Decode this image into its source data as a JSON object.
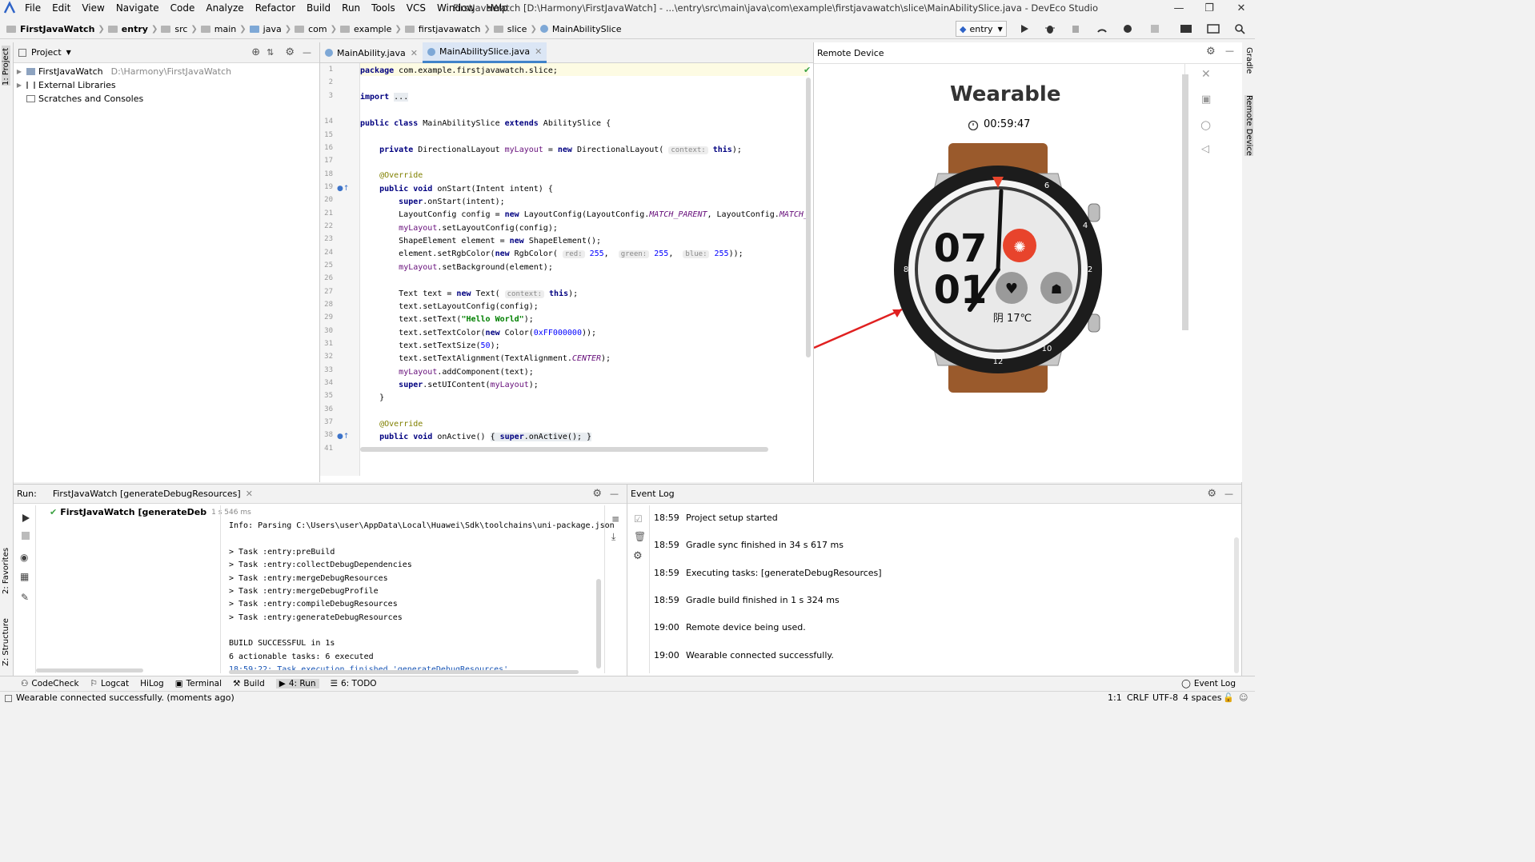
{
  "menu": [
    "File",
    "Edit",
    "View",
    "Navigate",
    "Code",
    "Analyze",
    "Refactor",
    "Build",
    "Run",
    "Tools",
    "VCS",
    "Window",
    "Help"
  ],
  "window_title": "FirstJavaWatch [D:\\Harmony\\FirstJavaWatch] - ...\\entry\\src\\main\\java\\com\\example\\firstjavawatch\\slice\\MainAbilitySlice.java - DevEco Studio",
  "breadcrumb": [
    "FirstJavaWatch",
    "entry",
    "src",
    "main",
    "java",
    "com",
    "example",
    "firstjavawatch",
    "slice",
    "MainAbilitySlice"
  ],
  "run_config": "entry",
  "left_strip": {
    "project": "1: Project",
    "favorites": "2: Favorites",
    "structure": "Z: Structure"
  },
  "right_strip": {
    "gradle": "Gradle",
    "remote": "Remote Device"
  },
  "project": {
    "title": "Project",
    "items": [
      {
        "name": "FirstJavaWatch",
        "path": "D:\\Harmony\\FirstJavaWatch"
      },
      {
        "name": "External Libraries",
        "path": ""
      },
      {
        "name": "Scratches and Consoles",
        "path": ""
      }
    ]
  },
  "editor": {
    "tabs": [
      "MainAbility.java",
      "MainAbilitySlice.java"
    ],
    "line_numbers": [
      "1",
      "2",
      "3",
      "14",
      "15",
      "16",
      "17",
      "18",
      "19",
      "20",
      "21",
      "22",
      "23",
      "24",
      "25",
      "26",
      "27",
      "28",
      "29",
      "30",
      "31",
      "32",
      "33",
      "34",
      "35",
      "36",
      "37",
      "38",
      "41"
    ]
  },
  "remote": {
    "title": "Remote Device",
    "device_label": "Wearable",
    "timer": "00:59:47",
    "watch": {
      "hour": "07",
      "minute": "01",
      "weather": "阴 17℃",
      "bezel_marks": [
        "2",
        "4",
        "6",
        "8",
        "10",
        "12"
      ]
    }
  },
  "run": {
    "label": "Run:",
    "tab": "FirstJavaWatch [generateDebugResources]",
    "tree_item": "FirstJavaWatch [generateDeb",
    "tree_time": "1 s 546 ms",
    "console": [
      "Info: Parsing C:\\Users\\user\\AppData\\Local\\Huawei\\Sdk\\toolchains\\uni-package.json",
      "",
      "> Task :entry:preBuild",
      "> Task :entry:collectDebugDependencies",
      "> Task :entry:mergeDebugResources",
      "> Task :entry:mergeDebugProfile",
      "> Task :entry:compileDebugResources",
      "> Task :entry:generateDebugResources",
      "",
      "BUILD SUCCESSFUL in 1s",
      "6 actionable tasks: 6 executed",
      "18:59:22: Task execution finished 'generateDebugResources'."
    ]
  },
  "event_log": {
    "title": "Event Log",
    "entries": [
      {
        "time": "18:59",
        "msg": "Project setup started"
      },
      {
        "time": "18:59",
        "msg": "Gradle sync finished in 34 s 617 ms"
      },
      {
        "time": "18:59",
        "msg": "Executing tasks: [generateDebugResources]"
      },
      {
        "time": "18:59",
        "msg": "Gradle build finished in 1 s 324 ms"
      },
      {
        "time": "19:00",
        "msg": "Remote device being used."
      },
      {
        "time": "19:00",
        "msg": "Wearable connected successfully."
      }
    ]
  },
  "bottom_tools": [
    "CodeCheck",
    "Logcat",
    "HiLog",
    "Terminal",
    "Build",
    "4: Run",
    "6: TODO"
  ],
  "event_log_button": "Event Log",
  "status": {
    "message": "Wearable connected successfully. (moments ago)",
    "position": "1:1",
    "line_sep": "CRLF",
    "encoding": "UTF-8",
    "indent": "4 spaces"
  },
  "colors": {
    "accent": "#4083c9",
    "watch_red": "#e8442c",
    "strap": "#9a5a2c"
  }
}
